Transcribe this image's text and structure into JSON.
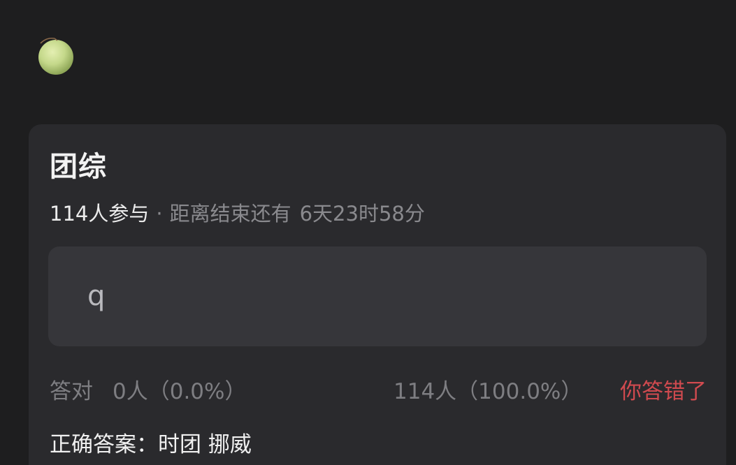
{
  "avatar": {
    "icon": "melon-icon"
  },
  "quiz": {
    "title": "团综",
    "participants": "114人参与",
    "separator": "·",
    "countdown_label": "距离结束还有",
    "countdown": "6天23时58分",
    "answer": "q",
    "correct_label": "答对",
    "correct_count": "0人（0.0%）",
    "wrong_count": "114人（100.0%）",
    "result": "你答错了",
    "correct_answer": "正确答案：时团 挪威"
  },
  "colors": {
    "background": "#1e1e1f",
    "card": "#2a2a2d",
    "answer_box": "#36363a",
    "result_red": "#d04a4f"
  }
}
